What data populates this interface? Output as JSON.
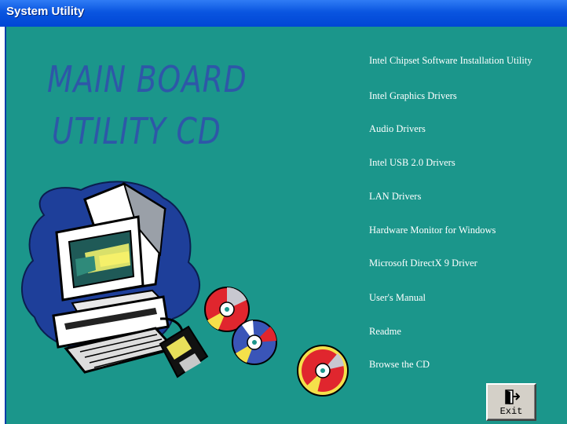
{
  "window": {
    "title": "System Utility"
  },
  "headline": {
    "line1": "MAIN BOARD",
    "line2": "UTILITY  CD"
  },
  "menu": {
    "items": [
      {
        "label": "Intel Chipset Software Installation Utility"
      },
      {
        "label": "Intel Graphics Drivers"
      },
      {
        "label": "Audio Drivers"
      },
      {
        "label": "Intel USB 2.0 Drivers"
      },
      {
        "label": "LAN Drivers"
      },
      {
        "label": "Hardware Monitor for Windows"
      },
      {
        "label": "Microsoft DirectX 9 Driver"
      },
      {
        "label": "User's Manual"
      },
      {
        "label": "Readme"
      },
      {
        "label": "Browse the CD"
      }
    ]
  },
  "exit_button": {
    "label": "Exit",
    "icon": "exit-door-icon"
  },
  "colors": {
    "background": "#1b968b",
    "titlebar": "#0a55e0",
    "headline": "#2e57a8",
    "menu_text": "#ffffff"
  }
}
